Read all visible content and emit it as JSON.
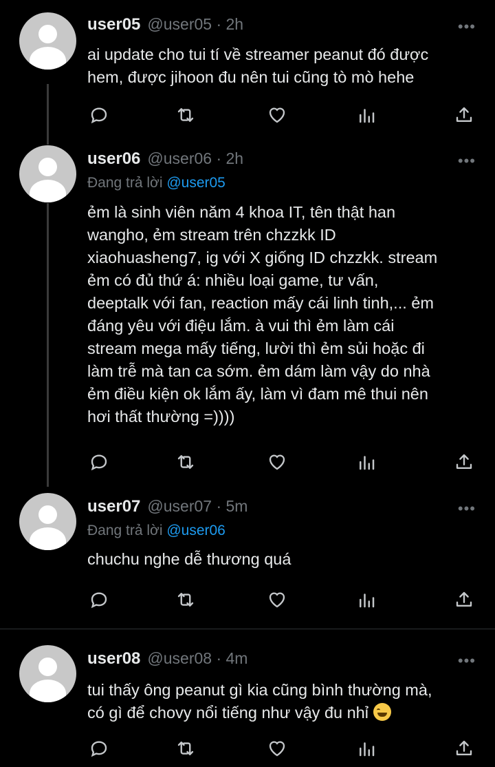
{
  "icons": {
    "reply": "reply-icon",
    "retweet": "retweet-icon",
    "like": "heart-icon",
    "views": "views-chart-icon",
    "share": "share-icon",
    "more": "more-dots-icon"
  },
  "colors": {
    "mention": "#1d9bf0",
    "secondary": "#71767b",
    "background": "#000000"
  },
  "tweets": [
    {
      "username": "user05",
      "handle": "@user05",
      "time": "· 2h",
      "more": "•••",
      "text": "ai update cho tui tí về streamer peanut đó được\nhem, được jihoon đu nên tui cũng tò mò hehe"
    },
    {
      "username": "user06",
      "handle": "@user06",
      "time": "· 2h",
      "more": "•••",
      "reply_prefix": "Đang trả lời",
      "reply_mention": "@user05",
      "text": "ẻm là sinh viên năm 4 khoa IT, tên thật han\nwangho, ẻm stream trên chzzkk ID\nxiaohuasheng7, ig với X giống ID chzzkk. stream\nẻm có đủ thứ á: nhiều loại game, tư vấn,\ndeeptalk với fan, reaction mấy cái linh tinh,... ẻm\nđáng yêu với điệu lắm. à vui thì ẻm làm cái\nstream mega mấy tiếng, lười thì ẻm sủi hoặc đi\nlàm trễ mà tan ca sớm. ẻm dám làm vậy do nhà\nẻm điều kiện ok lắm ấy, làm vì đam mê thui nên\nhơi thất thường =))))"
    },
    {
      "username": "user07",
      "handle": "@user07",
      "time": "· 5m",
      "more": "•••",
      "reply_prefix": "Đang trả lời",
      "reply_mention": "@user06",
      "text": "chuchu nghe dễ thương quá"
    },
    {
      "username": "user08",
      "handle": "@user08",
      "time": "· 4m",
      "more": "•••",
      "text": "tui thấy ông peanut gì kia cũng bình thường mà,\ncó gì để chovy nổi tiếng như vậy đu nhỉ",
      "emoji": "grinning-sweat-emoji"
    }
  ]
}
